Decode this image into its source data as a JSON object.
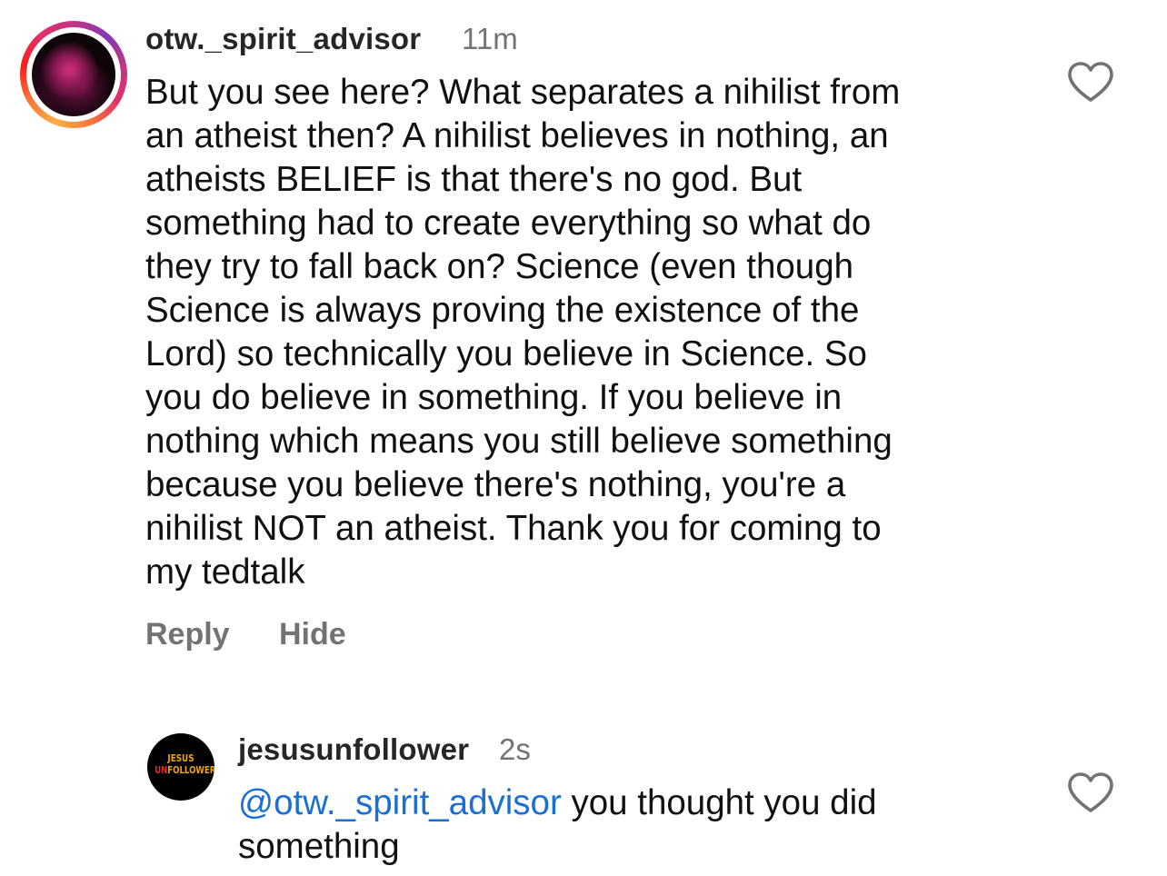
{
  "comments": [
    {
      "username": "otw._spirit_advisor",
      "time": "11m",
      "text": "But you see here? What separates a nihilist from\nan atheist then? A nihilist believes in nothing, an\natheists BELIEF is that there's no god. But\nsomething had to create everything so what do\nthey try to fall back on? Science (even though\nScience is always proving the existence of the\nLord) so technically you believe in Science.  So\nyou do believe in something. If you believe in\nnothing which means you still believe something\nbecause you believe there's nothing, you're a\nnihilist NOT an atheist. Thank you for coming to\nmy tedtalk",
      "actions": {
        "reply": "Reply",
        "hide": "Hide"
      },
      "avatar_has_story_ring": true,
      "like_icon": "heart-outline-icon"
    },
    {
      "username": "jesusunfollower",
      "time": "2s",
      "mention": "@otw._spirit_advisor",
      "text": " you thought you did\nsomething",
      "avatar_logo": {
        "line1": "JESUS",
        "line2_prefix": "UN",
        "line2_rest": "FOLLOWER"
      },
      "like_icon": "heart-outline-icon"
    }
  ],
  "colors": {
    "username": "#262626",
    "secondary_text": "#737373",
    "mention": "#1a6fd6",
    "logo_yellow": "#f2a500",
    "logo_red": "#e0301e"
  }
}
